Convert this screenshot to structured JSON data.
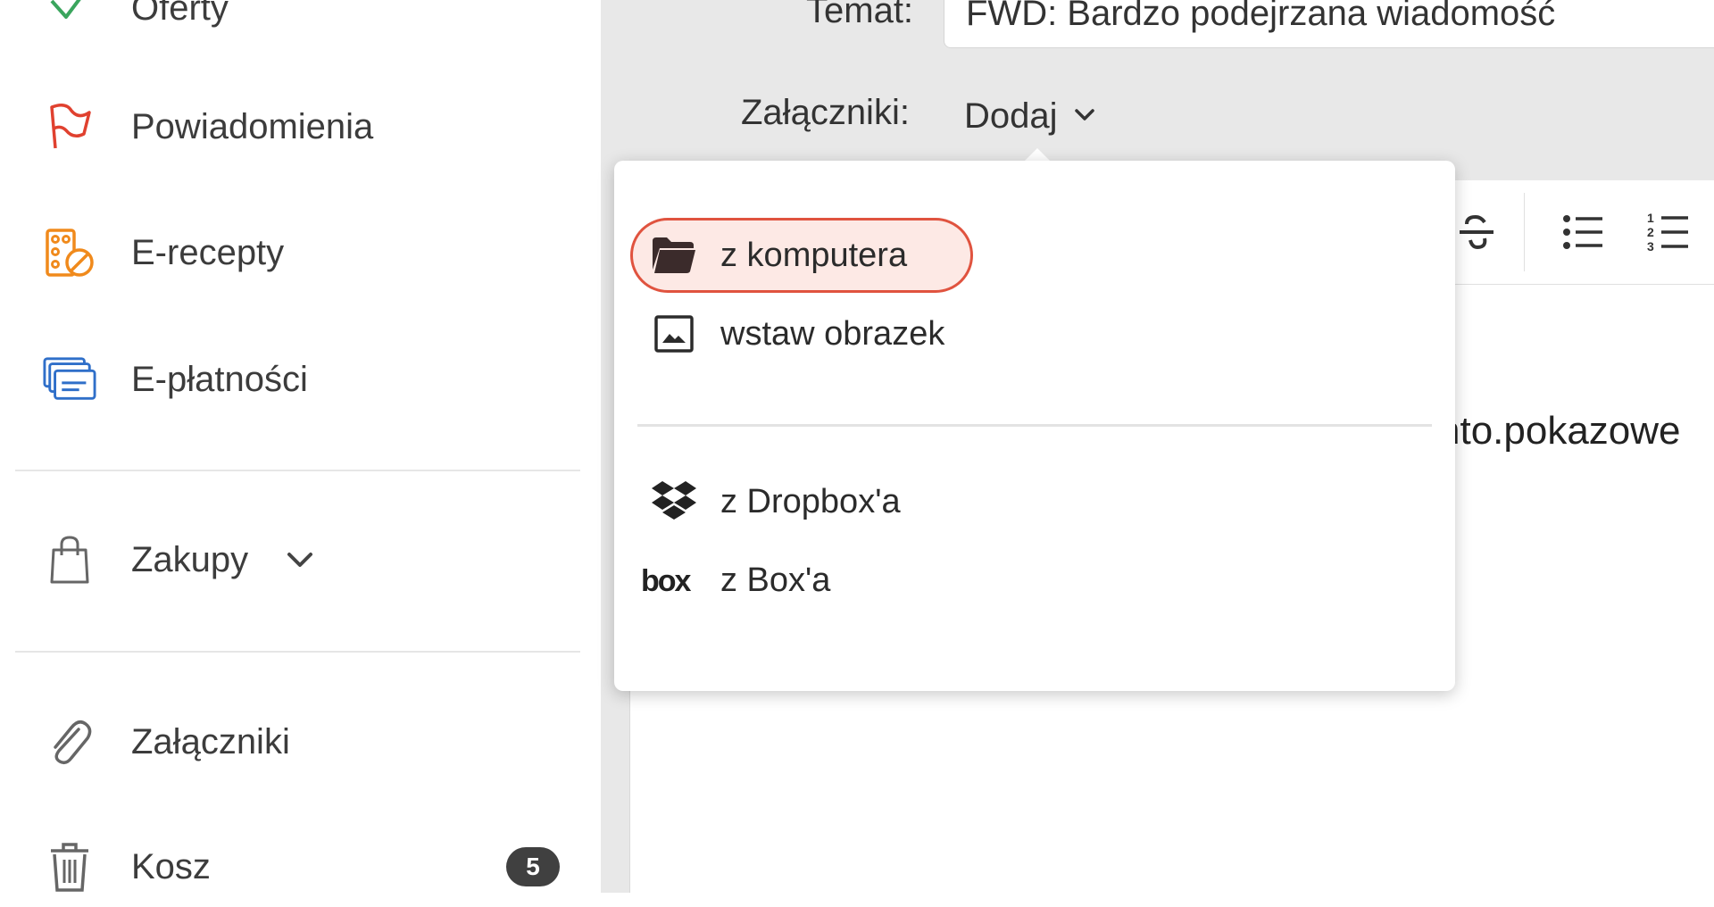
{
  "sidebar": {
    "items": [
      {
        "label": "Oferty",
        "icon": "check-icon",
        "color": "#3aa55d"
      },
      {
        "label": "Powiadomienia",
        "icon": "flag-icon",
        "color": "#e0412f"
      },
      {
        "label": "E-recepty",
        "icon": "pill-box-icon",
        "color": "#f08a1c"
      },
      {
        "label": "E-płatności",
        "icon": "cards-icon",
        "color": "#2f6fc9"
      },
      {
        "label": "Zakupy",
        "icon": "shopping-bag-icon",
        "color": "#666666"
      },
      {
        "label": "Załączniki",
        "icon": "paperclip-icon",
        "color": "#666666"
      },
      {
        "label": "Kosz",
        "icon": "trash-icon",
        "color": "#666666",
        "badge": "5"
      }
    ]
  },
  "compose": {
    "subject_label": "Temat:",
    "subject_value": "FWD: Bardzo podejrzana wiadomość",
    "attachments_label": "Załączniki:",
    "add_label": "Dodaj",
    "body_fragment": "nto.pokazowe"
  },
  "attach_menu": {
    "items": [
      {
        "label": "z komputera",
        "icon": "folder-icon"
      },
      {
        "label": "wstaw obrazek",
        "icon": "image-icon"
      },
      {
        "label": "z Dropbox'a",
        "icon": "dropbox-icon"
      },
      {
        "label": "z Box'a",
        "icon": "box-icon",
        "logo_text": "box"
      }
    ]
  },
  "colors": {
    "accent": "#e0533f",
    "highlight_bg": "#fde9e5",
    "badge_bg": "#404040"
  }
}
